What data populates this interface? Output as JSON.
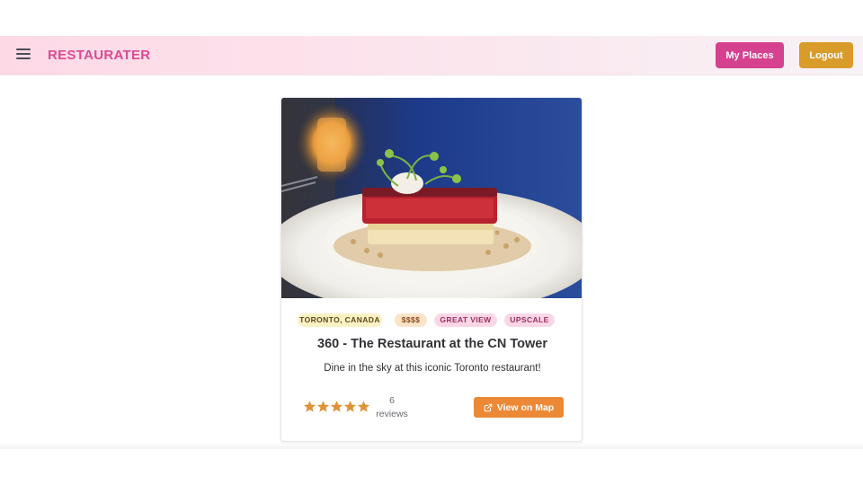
{
  "navbar": {
    "menu_icon": "hamburger-menu-icon",
    "brand": "RESTAURATER",
    "my_places_label": "My Places",
    "logout_label": "Logout",
    "colors": {
      "brand": "#dc4a92",
      "my_places_bg": "#d6418f",
      "logout_bg": "#d99c2a"
    }
  },
  "card": {
    "image_subject": "plated dish on white plate",
    "tags": [
      "TORONTO, CANADA",
      "$$$$",
      "GREAT VIEW",
      "UPSCALE"
    ],
    "title": "360 - The Restaurant at the CN Tower",
    "description": "Dine in the sky at this iconic Toronto restaurant!",
    "rating": {
      "stars": 5,
      "max": 5,
      "count": "6",
      "count_label": "reviews"
    },
    "map_button_label": "View on Map",
    "map_button_icon": "external-link-icon",
    "colors": {
      "star": "#e0923a",
      "map_button_bg": "#ed8936"
    }
  }
}
